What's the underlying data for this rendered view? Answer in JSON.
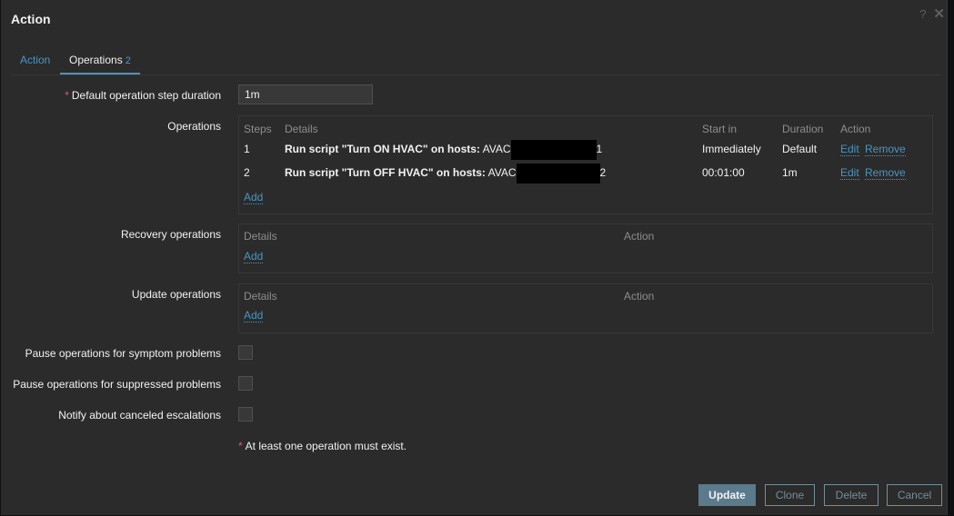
{
  "dialog": {
    "title": "Action",
    "help_icon": "?",
    "close_icon": "✕"
  },
  "tabs": [
    {
      "label": "Action"
    },
    {
      "label": "Operations",
      "count": "2"
    }
  ],
  "form": {
    "step_duration_label": "Default operation step duration",
    "required_mark": "*",
    "step_duration_value": "1m",
    "operations_label": "Operations",
    "recovery_label": "Recovery operations",
    "update_label": "Update operations",
    "pause_symptom_label": "Pause operations for symptom problems",
    "pause_suppressed_label": "Pause operations for suppressed problems",
    "notify_canceled_label": "Notify about canceled escalations",
    "note": "At least one operation must exist."
  },
  "operations": {
    "headers": {
      "steps": "Steps",
      "details": "Details",
      "start_in": "Start in",
      "duration": "Duration",
      "action": "Action"
    },
    "rows": [
      {
        "step": "1",
        "details": "Run script \"Turn ON HVAC\" on hosts:",
        "host_prefix": "AVAC",
        "host_suffix": "1",
        "start_in": "Immediately",
        "duration": "Default",
        "edit": "Edit",
        "remove": "Remove"
      },
      {
        "step": "2",
        "details": "Run script \"Turn OFF HVAC\" on hosts:",
        "host_prefix": "AVAC",
        "host_suffix": "2",
        "start_in": "00:01:00",
        "duration": "1m",
        "edit": "Edit",
        "remove": "Remove"
      }
    ],
    "add": "Add"
  },
  "recovery": {
    "headers": {
      "details": "Details",
      "action": "Action"
    },
    "add": "Add"
  },
  "update_ops": {
    "headers": {
      "details": "Details",
      "action": "Action"
    },
    "add": "Add"
  },
  "checkboxes": {
    "pause_symptom": false,
    "pause_suppressed": false,
    "notify_canceled": false
  },
  "buttons": {
    "update": "Update",
    "clone": "Clone",
    "delete": "Delete",
    "cancel": "Cancel"
  },
  "colors": {
    "background": "#2b2b2b",
    "link": "#4796c4",
    "required": "#e45959",
    "primary_button": "#5b7a8c"
  }
}
